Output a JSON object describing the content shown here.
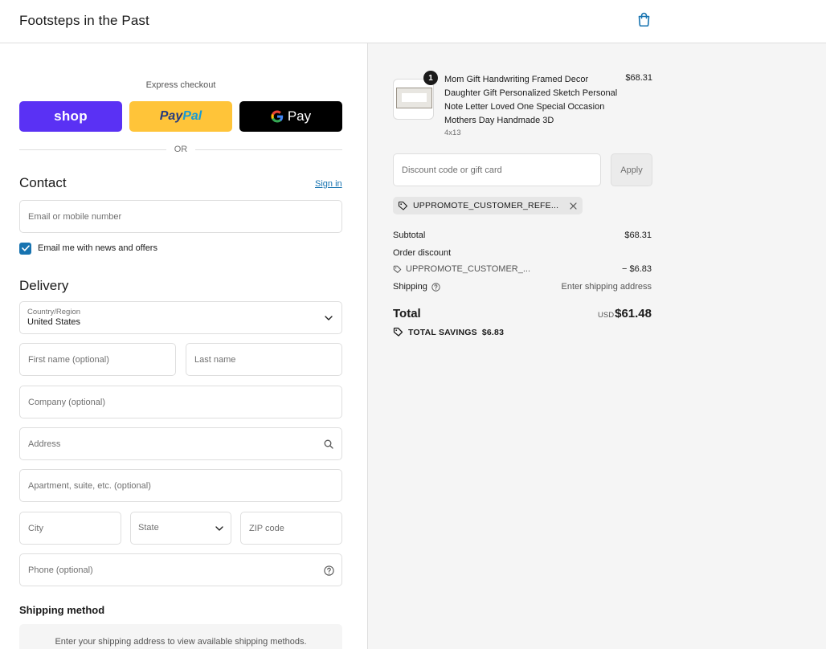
{
  "header": {
    "store_name": "Footsteps in the Past"
  },
  "express": {
    "label": "Express checkout",
    "shop_label": "shop",
    "paypal_label": "PayPal",
    "gpay_label": "Pay",
    "or_label": "OR"
  },
  "contact": {
    "title": "Contact",
    "sign_in": "Sign in",
    "email_placeholder": "Email or mobile number",
    "newsletter_label": "Email me with news and offers",
    "newsletter_checked": true
  },
  "delivery": {
    "title": "Delivery",
    "country_label": "Country/Region",
    "country_value": "United States",
    "first_name_placeholder": "First name (optional)",
    "last_name_placeholder": "Last name",
    "company_placeholder": "Company (optional)",
    "address_placeholder": "Address",
    "apartment_placeholder": "Apartment, suite, etc. (optional)",
    "city_placeholder": "City",
    "state_label": "State",
    "zip_placeholder": "ZIP code",
    "phone_placeholder": "Phone (optional)"
  },
  "shipping_method": {
    "title": "Shipping method",
    "message": "Enter your shipping address to view available shipping methods."
  },
  "summary": {
    "product": {
      "name": "Mom Gift Handwriting Framed Decor Daughter Gift Personalized Sketch Personal Note Letter Loved One Special Occasion Mothers Day Handmade 3D",
      "variant": "4x13",
      "price": "$68.31",
      "quantity": "1"
    },
    "discount_placeholder": "Discount code or gift card",
    "apply_label": "Apply",
    "applied_code": "UPPROMOTE_CUSTOMER_REFE...",
    "subtotal_label": "Subtotal",
    "subtotal_value": "$68.31",
    "order_discount_label": "Order discount",
    "discount_code_short": "UPPROMOTE_CUSTOMER_...",
    "discount_value": "− $6.83",
    "shipping_label": "Shipping",
    "shipping_value": "Enter shipping address",
    "total_label": "Total",
    "currency": "USD",
    "total_value": "$61.48",
    "savings_label": "TOTAL SAVINGS",
    "savings_value": "$6.83"
  },
  "colors": {
    "shop_purple": "#5a31f4",
    "paypal_yellow": "#ffc439",
    "link_blue": "#1773b0",
    "summary_bg": "#f5f5f5"
  },
  "icons": {
    "cart": "shopping-bag-icon",
    "chevron": "chevron-down-icon",
    "search": "search-icon",
    "help": "help-circle-icon",
    "tag": "tag-icon",
    "close": "close-icon",
    "check": "check-icon"
  }
}
